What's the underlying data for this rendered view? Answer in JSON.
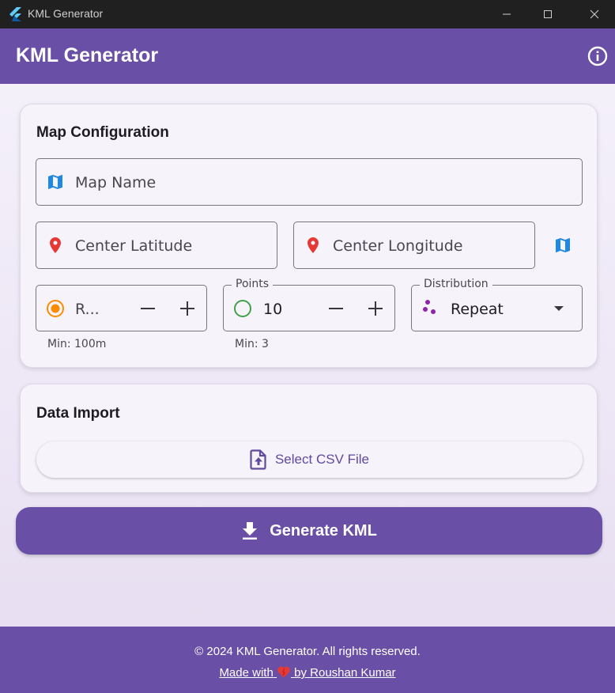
{
  "window": {
    "title": "KML Generator",
    "controls": [
      "minimize",
      "maximize",
      "close"
    ]
  },
  "appbar": {
    "title": "KML Generator",
    "info_icon": "info-icon"
  },
  "map_config": {
    "title": "Map Configuration",
    "map_name_label": "Map Name",
    "center_lat_label": "Center Latitude",
    "center_lng_label": "Center Longitude",
    "radius": {
      "label": "R...",
      "helper": "Min: 100m"
    },
    "points": {
      "label": "Points",
      "value": "10",
      "helper": "Min: 3"
    },
    "distribution": {
      "label": "Distribution",
      "value": "Repeat"
    }
  },
  "data_import": {
    "title": "Data Import",
    "select_csv_label": "Select CSV File"
  },
  "generate_label": "Generate KML",
  "footer": {
    "copyright": "© 2024 KML Generator. All rights reserved.",
    "made_prefix": "Made with",
    "made_suffix": "by Roushan Kumar"
  },
  "colors": {
    "primary": "#6a4fa6",
    "location_pin": "#e53935",
    "map_icon": "#1e88e5",
    "radius_icon": "#fb8c00",
    "points_icon": "#43a047",
    "distribution_icon": "#8e24aa",
    "heart": "#e53935"
  }
}
